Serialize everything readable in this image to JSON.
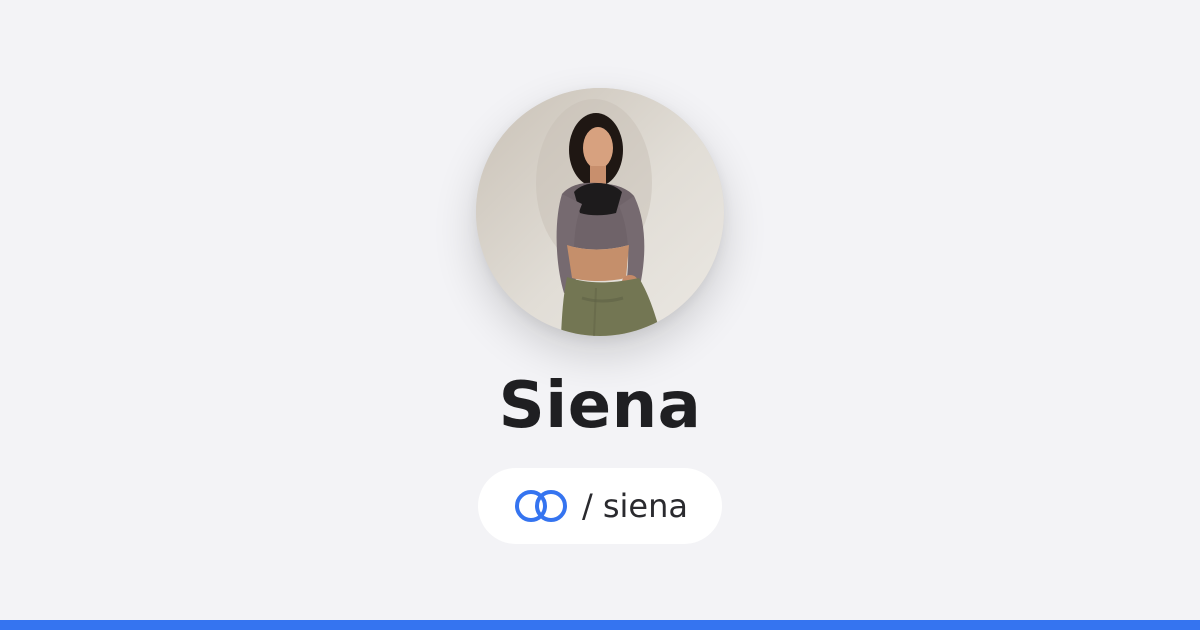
{
  "profile": {
    "display_name": "Siena",
    "handle_separator": "/",
    "handle": "siena",
    "avatar": "profile-photo"
  },
  "brand": {
    "logo_icon": "link-rings-icon",
    "accent_color": "#3574f0",
    "background_color": "#f3f3f6"
  }
}
